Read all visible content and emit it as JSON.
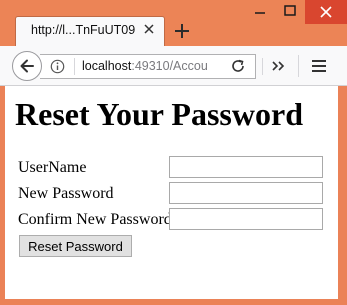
{
  "browser": {
    "tab_title": "http://l...TnFuUT09",
    "url_host": "localhost",
    "url_rest": ":49310/Accou"
  },
  "icons": {
    "tab_close": "close-icon",
    "new_tab": "plus-icon",
    "back": "back-arrow-icon",
    "site_info": "info-icon",
    "reload": "reload-icon",
    "overflow": "double-chevron-icon",
    "menu": "hamburger-menu-icon",
    "minimize": "minimize-icon",
    "maximize": "maximize-icon",
    "close_window": "close-icon"
  },
  "colors": {
    "titlebar": "#ec8456",
    "close_button": "#d9462f"
  },
  "page": {
    "title": "Reset Your Password",
    "fields": [
      {
        "label": "UserName",
        "value": ""
      },
      {
        "label": "New Password",
        "value": ""
      },
      {
        "label": "Confirm New Password",
        "value": ""
      }
    ],
    "submit_label": "Reset Password"
  }
}
